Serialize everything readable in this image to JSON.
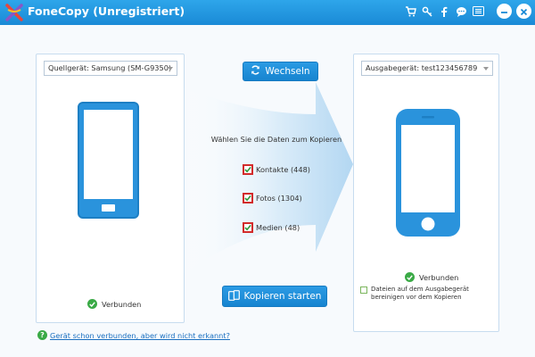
{
  "window": {
    "title": "FoneCopy (Unregistriert)"
  },
  "titlebar": {
    "icons": [
      "cart-icon",
      "key-icon",
      "facebook-icon",
      "chat-icon",
      "menu-icon",
      "minimize-icon",
      "close-icon"
    ]
  },
  "source": {
    "dropdown_value": "Quellgerät: Samsung (SM-G9350)",
    "status": "Verbunden"
  },
  "target": {
    "dropdown_value": "Ausgabegerät: test123456789",
    "status": "Verbunden",
    "clear_option": "Dateien auf dem Ausgabegerät bereinigen vor dem Kopieren"
  },
  "center": {
    "switch_button": "Wechseln",
    "choose_label": "Wählen Sie die Daten zum Kopieren",
    "options": [
      {
        "label": "Kontakte (448)",
        "checked": true
      },
      {
        "label": "Fotos (1304)",
        "checked": true
      },
      {
        "label": "Medien (48)",
        "checked": true
      }
    ],
    "copy_button": "Kopieren starten"
  },
  "footer": {
    "help_icon": "?",
    "help_link": "Gerät schon verbunden, aber wird nicht erkannt?"
  },
  "colors": {
    "titlebar": "#1a8ad6",
    "accent": "#1784d0",
    "success": "#3aaa46",
    "checkbox_border": "#d22b2b"
  }
}
